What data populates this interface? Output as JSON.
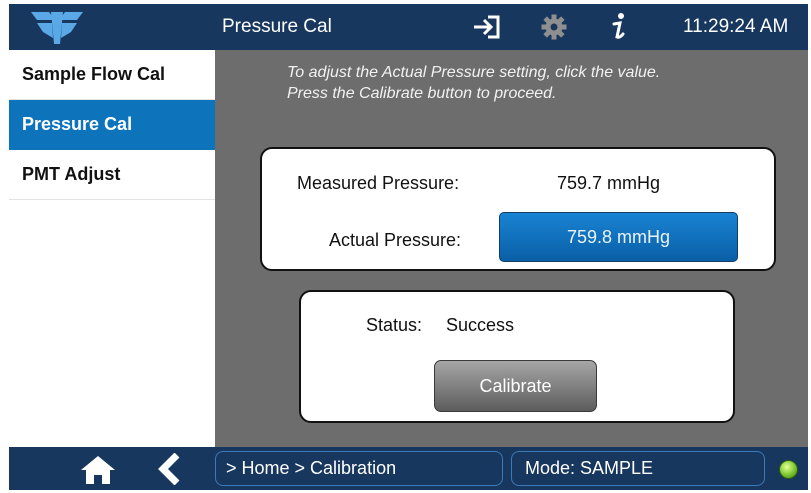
{
  "header": {
    "title": "Pressure Cal",
    "time": "11:29:24 AM",
    "icons": [
      "teledyne-logo",
      "login-icon",
      "gear-icon",
      "info-icon"
    ]
  },
  "sidebar": {
    "items": [
      {
        "label": "Sample Flow Cal",
        "active": false
      },
      {
        "label": "Pressure Cal",
        "active": true
      },
      {
        "label": "PMT Adjust",
        "active": false
      }
    ]
  },
  "main": {
    "instructions": [
      "To adjust the Actual Pressure setting, click the value.",
      "Press the Calibrate button to proceed."
    ],
    "measured_label": "Measured Pressure:",
    "measured_value": "759.7 mmHg",
    "actual_label": "Actual Pressure:",
    "actual_value": "759.8 mmHg",
    "status_label": "Status:",
    "status_value": "Success",
    "calibrate_label": "Calibrate"
  },
  "footer": {
    "breadcrumb": "> Home > Calibration",
    "mode": "Mode: SAMPLE",
    "icons": [
      "home-icon",
      "back-icon",
      "status-led"
    ]
  },
  "colors": {
    "header_bg": "#17375e",
    "active_item": "#0d73ba",
    "panel_bg": "#6d6d6d",
    "accent_button": "#0d73ba",
    "status_led": "#8ad23a"
  }
}
